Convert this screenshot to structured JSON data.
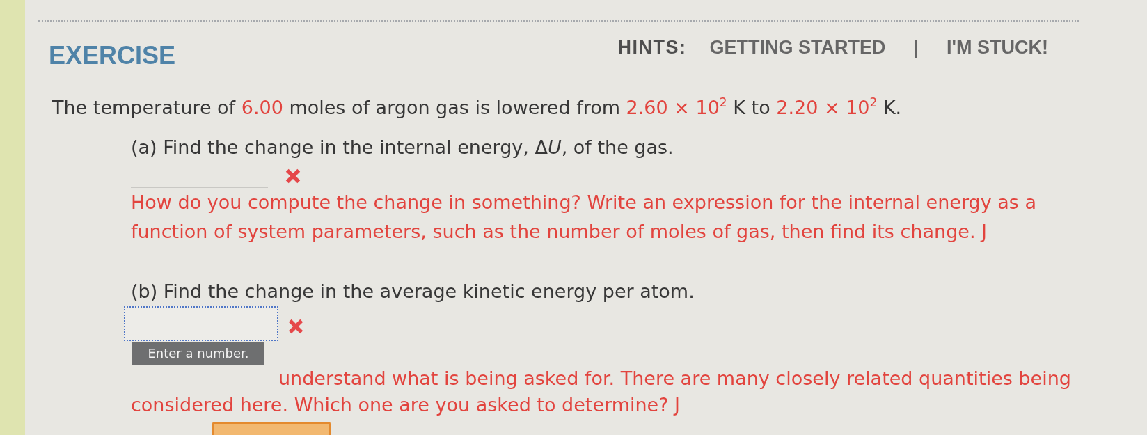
{
  "exercise": {
    "title": "EXERCISE"
  },
  "hints": {
    "label": "HINTS:",
    "separator": "|",
    "links": [
      {
        "label": "GETTING STARTED"
      },
      {
        "label": "I'M STUCK!"
      }
    ]
  },
  "statement": [
    {
      "kind": "text",
      "text": "The temperature of "
    },
    {
      "kind": "value",
      "text": "6.00"
    },
    {
      "kind": "text",
      "text": " moles of argon gas is lowered from "
    },
    {
      "kind": "value",
      "text": "2.60 × 10$^{2}$"
    },
    {
      "kind": "text",
      "text": " K to "
    },
    {
      "kind": "value",
      "text": "2.20 × 10$^{2}$"
    },
    {
      "kind": "text",
      "text": " K."
    }
  ],
  "parts": [
    {
      "question": [
        {
          "kind": "text",
          "text": "(a) Find the change in the internal energy, Δ"
        },
        {
          "kind": "math",
          "text": "U"
        },
        {
          "kind": "text",
          "text": ", of the gas."
        }
      ],
      "answer": {
        "focused": false,
        "correct": false
      },
      "feedback": "How do you compute the change in something? Write an expression for the internal energy as a function of system parameters, such as the number of moles of gas, then find its change. J"
    },
    {
      "question": [
        {
          "kind": "text",
          "text": "(b) Find the change in the average kinetic energy per atom."
        }
      ],
      "answer": {
        "focused": true,
        "correct": false,
        "tooltip": "Enter a number."
      },
      "feedback": "understand what is being asked for. There are many closely related quantities being considered here. Which one are you asked to determine? J"
    }
  ]
}
